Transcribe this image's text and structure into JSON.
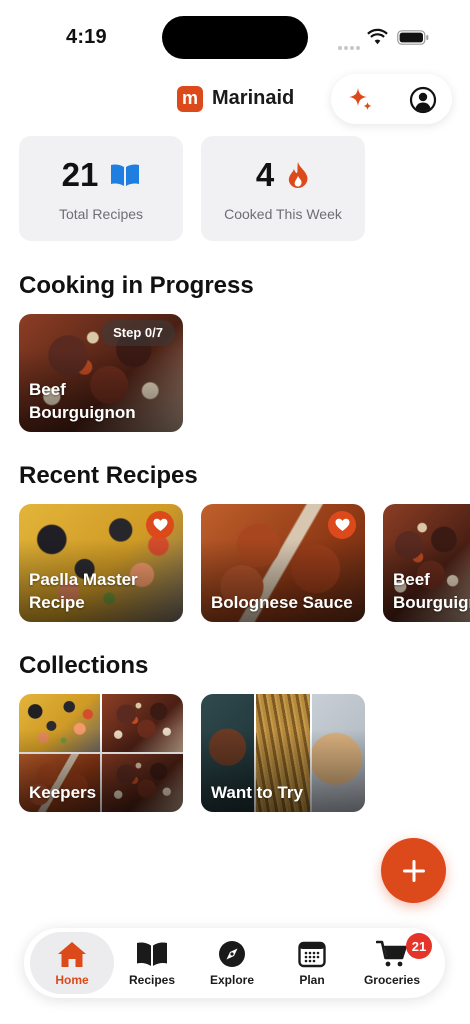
{
  "status_bar": {
    "time": "4:19"
  },
  "header": {
    "brand_logo_letter": "m",
    "brand_name": "Marinaid",
    "brand_color": "#dc4a1c"
  },
  "stats": [
    {
      "value": "21",
      "label": "Total Recipes",
      "icon": "book-icon",
      "icon_color": "#1f7fe0"
    },
    {
      "value": "4",
      "label": "Cooked This Week",
      "icon": "flame-icon",
      "icon_color": "#dc4a1c"
    }
  ],
  "sections": {
    "in_progress": "Cooking in Progress",
    "recent": "Recent Recipes",
    "collections": "Collections"
  },
  "in_progress": [
    {
      "title": "Beef Bourguignon",
      "step": "Step 0/7"
    }
  ],
  "recent_recipes": [
    {
      "title": "Paella Master Recipe",
      "favorited": true
    },
    {
      "title": "Bolognese Sauce",
      "favorited": true
    },
    {
      "title": "Beef Bourguignon",
      "favorited": false
    }
  ],
  "collections": [
    {
      "title": "Keepers"
    },
    {
      "title": "Want to Try"
    }
  ],
  "tabbar": {
    "items": [
      {
        "label": "Home",
        "icon": "home-icon",
        "active": true
      },
      {
        "label": "Recipes",
        "icon": "book-icon",
        "active": false
      },
      {
        "label": "Explore",
        "icon": "compass-icon",
        "active": false
      },
      {
        "label": "Plan",
        "icon": "calendar-icon",
        "active": false
      },
      {
        "label": "Groceries",
        "icon": "cart-icon",
        "active": false
      }
    ],
    "groceries_badge": "21"
  },
  "colors": {
    "accent": "#dc4a1c",
    "card_bg": "#f1f1f4",
    "badge_red": "#e5352b"
  }
}
